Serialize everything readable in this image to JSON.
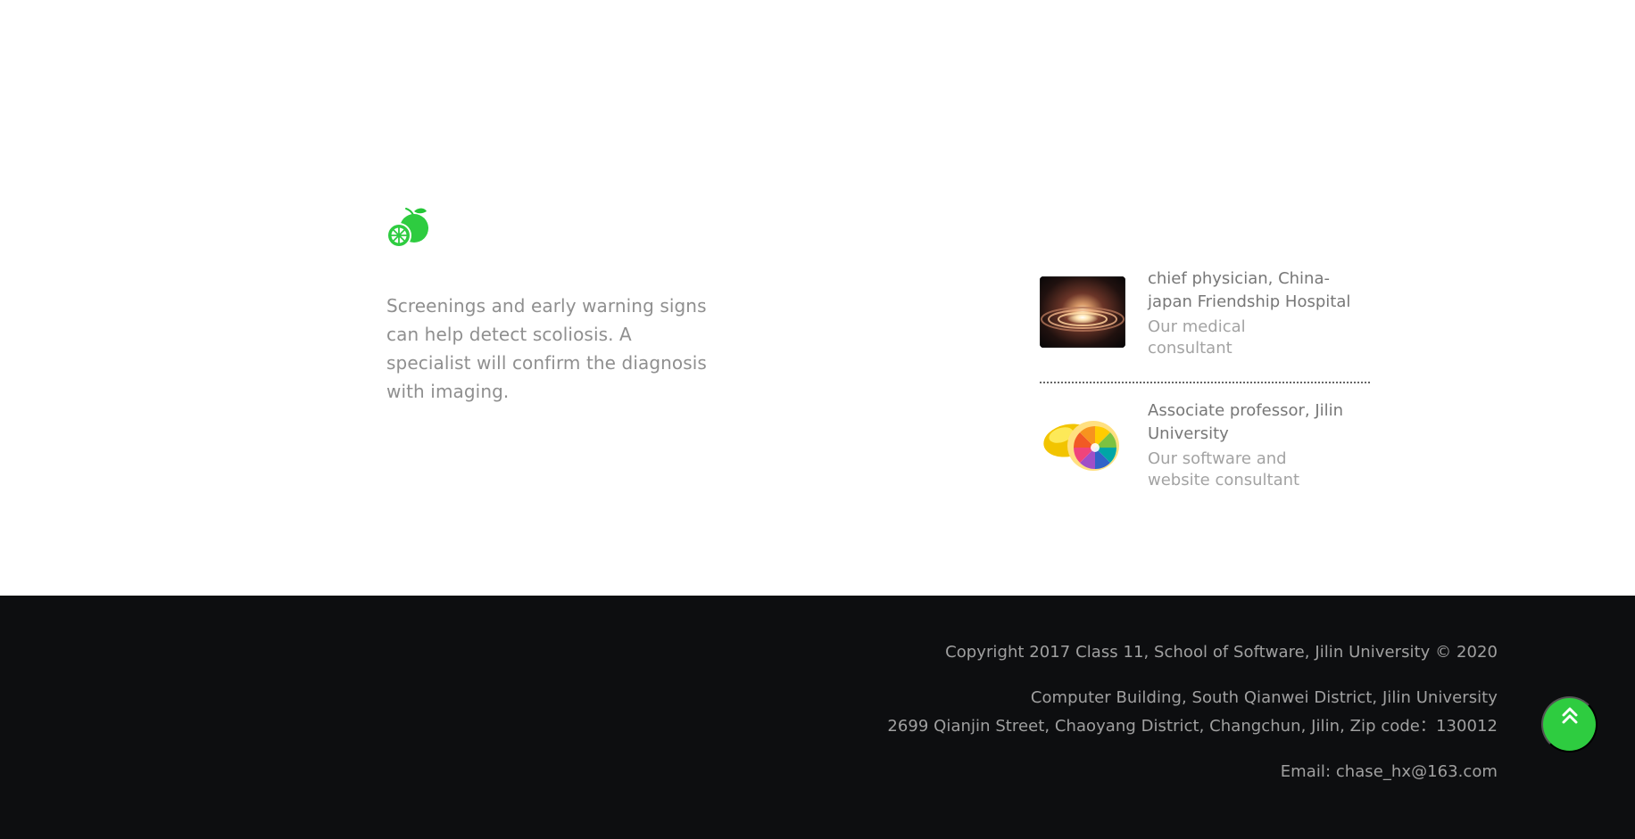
{
  "feature": {
    "icon": "lime-fruit-icon",
    "text": "Screenings and early warning signs can help detect scoliosis. A specialist will confirm the diagnosis with imaging."
  },
  "consultants": [
    {
      "image": "galaxy-photo",
      "title": "chief physician, China-japan Friendship Hospital",
      "role": "Our medical consultant"
    },
    {
      "image": "lemon-color-wheel-photo",
      "title": "Associate professor, Jilin University",
      "role": "Our software and website consultant"
    }
  ],
  "footer": {
    "copyright": "Copyright 2017 Class 11, School of Software, Jilin University © 2020",
    "address_line_1": "Computer Building, South Qianwei District, Jilin University",
    "address_line_2": "2699 Qianjin Street, Chaoyang District, Changchun, Jilin, Zip code：130012",
    "email": "Email: chase_hx@163.com"
  },
  "back_to_top": {
    "icon": "double-chevron-up-icon",
    "color": "#2ecc40"
  },
  "colors": {
    "footer_background": "#0d0e10",
    "accent_green": "#2ecc40",
    "body_text": "#8f8f8f"
  }
}
